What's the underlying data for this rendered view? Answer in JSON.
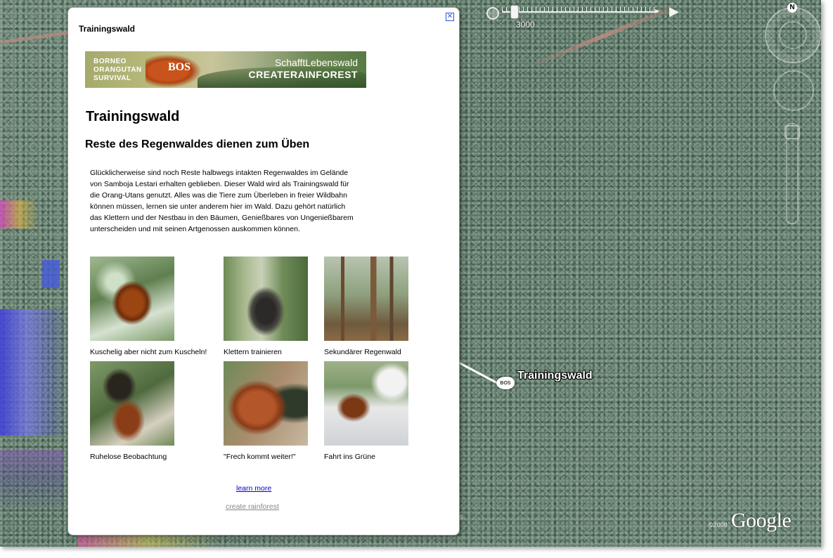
{
  "map": {
    "time_label": "3000",
    "north_label": "N",
    "placemark_label": "Trainingswald",
    "placemark_icon_text": "BOS",
    "copyright": "©2008",
    "google_logo": "Google",
    "partial_text": "s"
  },
  "balloon": {
    "title": "Trainingswald",
    "close_glyph": "✕",
    "banner": {
      "left_text_line1": "BORNEO",
      "left_text_line2": "ORANGUTAN",
      "left_text_line3": "SURVIVAL",
      "logo_text": "BOS",
      "tagline1": "SchafftLebenswald",
      "tagline2": "CREATERAINFOREST"
    },
    "heading": "Trainingswald",
    "subheading": "Reste des Regenwaldes dienen zum Üben",
    "intro_lines": [
      "Glücklicherweise sind noch Reste halbwegs intakten Regenwaldes im Gelände",
      "von Samboja Lestari erhalten geblieben. Dieser Wald wird als Trainingswald für",
      "die Orang-Utans genutzt. Alles was die Tiere zum Überleben in freier Wildbahn",
      "können müssen, lernen sie unter anderem hier im Wald. Dazu gehört natürlich",
      "das Klettern und der Nestbau in den Bäumen, Genießbares von Ungenießbarem",
      "unterscheiden und mit seinen Artgenossen auskommen können."
    ],
    "photos": [
      {
        "caption": "Kuschelig aber nicht zum Kuscheln!"
      },
      {
        "caption": "Klettern trainieren"
      },
      {
        "caption": "Sekundärer Regenwald"
      },
      {
        "caption": "Ruhelose Beobachtung"
      },
      {
        "caption": "\"Frech kommt weiter!\""
      },
      {
        "caption": "Fahrt ins Grüne"
      }
    ],
    "learn_more": "learn more",
    "create_link": "create rainforest"
  },
  "colors": {
    "link": "#0000cc",
    "visited_link": "#888888",
    "placemark_text": "#ffffff"
  }
}
